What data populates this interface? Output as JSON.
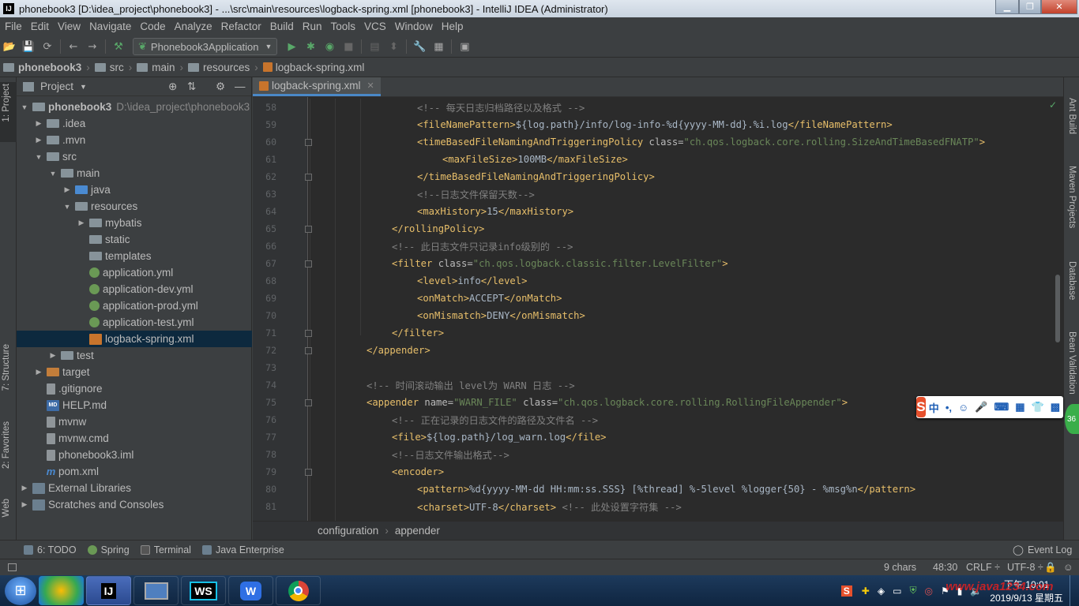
{
  "window": {
    "title": "phonebook3 [D:\\idea_project\\phonebook3] - ...\\src\\main\\resources\\logback-spring.xml [phonebook3] - IntelliJ IDEA (Administrator)",
    "app_icon": "IJ"
  },
  "menu": [
    "File",
    "Edit",
    "View",
    "Navigate",
    "Code",
    "Analyze",
    "Refactor",
    "Build",
    "Run",
    "Tools",
    "VCS",
    "Window",
    "Help"
  ],
  "toolbar": {
    "run_config": "Phonebook3Application"
  },
  "breadcrumbs": [
    "phonebook3",
    "src",
    "main",
    "resources",
    "logback-spring.xml"
  ],
  "left_strip": {
    "project": "1: Project",
    "structure": "7: Structure",
    "favorites": "2: Favorites",
    "web": "Web"
  },
  "right_strip": {
    "ant": "Ant Build",
    "maven": "Maven Projects",
    "database": "Database",
    "bean": "Bean Validation"
  },
  "project_panel": {
    "title": "Project",
    "tree": [
      {
        "label": "phonebook3",
        "hint": "D:\\idea_project\\phonebook3",
        "level": 0,
        "arrow": "▼",
        "icon": "folder",
        "bold": true
      },
      {
        "label": ".idea",
        "level": 1,
        "arrow": "▶",
        "icon": "folder"
      },
      {
        "label": ".mvn",
        "level": 1,
        "arrow": "▶",
        "icon": "folder"
      },
      {
        "label": "src",
        "level": 1,
        "arrow": "▼",
        "icon": "folder"
      },
      {
        "label": "main",
        "level": 2,
        "arrow": "▼",
        "icon": "folder"
      },
      {
        "label": "java",
        "level": 3,
        "arrow": "▶",
        "icon": "folder-blue"
      },
      {
        "label": "resources",
        "level": 3,
        "arrow": "▼",
        "icon": "folder"
      },
      {
        "label": "mybatis",
        "level": 4,
        "arrow": "▶",
        "icon": "folder"
      },
      {
        "label": "static",
        "level": 4,
        "arrow": "",
        "icon": "folder"
      },
      {
        "label": "templates",
        "level": 4,
        "arrow": "",
        "icon": "folder"
      },
      {
        "label": "application.yml",
        "level": 4,
        "arrow": "",
        "icon": "yml"
      },
      {
        "label": "application-dev.yml",
        "level": 4,
        "arrow": "",
        "icon": "yml"
      },
      {
        "label": "application-prod.yml",
        "level": 4,
        "arrow": "",
        "icon": "yml"
      },
      {
        "label": "application-test.yml",
        "level": 4,
        "arrow": "",
        "icon": "yml"
      },
      {
        "label": "logback-spring.xml",
        "level": 4,
        "arrow": "",
        "icon": "xml",
        "selected": true
      },
      {
        "label": "test",
        "level": 2,
        "arrow": "▶",
        "icon": "folder"
      },
      {
        "label": "target",
        "level": 1,
        "arrow": "▶",
        "icon": "folder-orange"
      },
      {
        "label": ".gitignore",
        "level": 1,
        "arrow": "",
        "icon": "file"
      },
      {
        "label": "HELP.md",
        "level": 1,
        "arrow": "",
        "icon": "md"
      },
      {
        "label": "mvnw",
        "level": 1,
        "arrow": "",
        "icon": "file"
      },
      {
        "label": "mvnw.cmd",
        "level": 1,
        "arrow": "",
        "icon": "file"
      },
      {
        "label": "phonebook3.iml",
        "level": 1,
        "arrow": "",
        "icon": "file"
      },
      {
        "label": "pom.xml",
        "level": 1,
        "arrow": "",
        "icon": "mvn"
      },
      {
        "label": "External Libraries",
        "level": 0,
        "arrow": "▶",
        "icon": "lib"
      },
      {
        "label": "Scratches and Consoles",
        "level": 0,
        "arrow": "▶",
        "icon": "lib"
      }
    ]
  },
  "editor": {
    "tab": "logback-spring.xml",
    "lines": [
      {
        "n": "58",
        "indent": 6,
        "fold": false,
        "tokens": [
          [
            "c",
            "<!-- 每天日志归档路径以及格式 -->"
          ]
        ]
      },
      {
        "n": "59",
        "indent": 6,
        "fold": false,
        "tokens": [
          [
            "t",
            "<fileNamePattern>"
          ],
          [
            "x",
            "${log.path}/info/log-info-%d{yyyy-MM-dd}.%i.log"
          ],
          [
            "t",
            "</fileNamePattern>"
          ]
        ]
      },
      {
        "n": "60",
        "indent": 6,
        "fold": true,
        "tokens": [
          [
            "t",
            "<timeBasedFileNamingAndTriggeringPolicy "
          ],
          [
            "a",
            "class="
          ],
          [
            "v",
            "\"ch.qos.logback.core.rolling.SizeAndTimeBasedFNATP\""
          ],
          [
            "t",
            ">"
          ]
        ]
      },
      {
        "n": "61",
        "indent": 8,
        "fold": false,
        "tokens": [
          [
            "t",
            "<maxFileSize>"
          ],
          [
            "x",
            "100MB"
          ],
          [
            "t",
            "</maxFileSize>"
          ]
        ]
      },
      {
        "n": "62",
        "indent": 6,
        "fold": true,
        "tokens": [
          [
            "t",
            "</timeBasedFileNamingAndTriggeringPolicy>"
          ]
        ]
      },
      {
        "n": "63",
        "indent": 6,
        "fold": false,
        "tokens": [
          [
            "c",
            "<!--日志文件保留天数-->"
          ]
        ]
      },
      {
        "n": "64",
        "indent": 6,
        "fold": false,
        "tokens": [
          [
            "t",
            "<maxHistory>"
          ],
          [
            "x",
            "15"
          ],
          [
            "t",
            "</maxHistory>"
          ]
        ]
      },
      {
        "n": "65",
        "indent": 4,
        "fold": true,
        "tokens": [
          [
            "t",
            "</rollingPolicy>"
          ]
        ]
      },
      {
        "n": "66",
        "indent": 4,
        "fold": false,
        "tokens": [
          [
            "c",
            "<!-- 此日志文件只记录info级别的 -->"
          ]
        ]
      },
      {
        "n": "67",
        "indent": 4,
        "fold": true,
        "tokens": [
          [
            "t",
            "<filter "
          ],
          [
            "a",
            "class="
          ],
          [
            "v",
            "\"ch.qos.logback.classic.filter.LevelFilter\""
          ],
          [
            "t",
            ">"
          ]
        ]
      },
      {
        "n": "68",
        "indent": 6,
        "fold": false,
        "tokens": [
          [
            "t",
            "<level>"
          ],
          [
            "x",
            "info"
          ],
          [
            "t",
            "</level>"
          ]
        ]
      },
      {
        "n": "69",
        "indent": 6,
        "fold": false,
        "tokens": [
          [
            "t",
            "<onMatch>"
          ],
          [
            "x",
            "ACCEPT"
          ],
          [
            "t",
            "</onMatch>"
          ]
        ]
      },
      {
        "n": "70",
        "indent": 6,
        "fold": false,
        "tokens": [
          [
            "t",
            "<onMismatch>"
          ],
          [
            "x",
            "DENY"
          ],
          [
            "t",
            "</onMismatch>"
          ]
        ]
      },
      {
        "n": "71",
        "indent": 4,
        "fold": true,
        "tokens": [
          [
            "t",
            "</filter>"
          ]
        ]
      },
      {
        "n": "72",
        "indent": 2,
        "fold": true,
        "tokens": [
          [
            "t",
            "</appender>"
          ]
        ]
      },
      {
        "n": "73",
        "indent": 0,
        "fold": false,
        "tokens": []
      },
      {
        "n": "74",
        "indent": 2,
        "fold": false,
        "tokens": [
          [
            "c",
            "<!-- 时间滚动输出 level为 WARN 日志 -->"
          ]
        ]
      },
      {
        "n": "75",
        "indent": 2,
        "fold": true,
        "tokens": [
          [
            "t",
            "<appender "
          ],
          [
            "a",
            "name="
          ],
          [
            "v",
            "\"WARN_FILE\" "
          ],
          [
            "a",
            "class="
          ],
          [
            "v",
            "\"ch.qos.logback.core.rolling.RollingFileAppender\""
          ],
          [
            "t",
            ">"
          ]
        ]
      },
      {
        "n": "76",
        "indent": 4,
        "fold": false,
        "tokens": [
          [
            "c",
            "<!-- 正在记录的日志文件的路径及文件名 -->"
          ]
        ]
      },
      {
        "n": "77",
        "indent": 4,
        "fold": false,
        "tokens": [
          [
            "t",
            "<file>"
          ],
          [
            "x",
            "${log.path}/log_warn.log"
          ],
          [
            "t",
            "</file>"
          ]
        ]
      },
      {
        "n": "78",
        "indent": 4,
        "fold": false,
        "tokens": [
          [
            "c",
            "<!--日志文件输出格式-->"
          ]
        ]
      },
      {
        "n": "79",
        "indent": 4,
        "fold": true,
        "tokens": [
          [
            "t",
            "<encoder>"
          ]
        ]
      },
      {
        "n": "80",
        "indent": 6,
        "fold": false,
        "tokens": [
          [
            "t",
            "<pattern>"
          ],
          [
            "x",
            "%d{yyyy-MM-dd HH:mm:ss.SSS} [%thread] %-5level %logger{50} - %msg%n"
          ],
          [
            "t",
            "</pattern>"
          ]
        ]
      },
      {
        "n": "81",
        "indent": 6,
        "fold": false,
        "tokens": [
          [
            "t",
            "<charset>"
          ],
          [
            "x",
            "UTF-8"
          ],
          [
            "t",
            "</charset> "
          ],
          [
            "c",
            "<!-- 此处设置字符集 -->"
          ]
        ]
      }
    ]
  },
  "editor_breadcrumb": [
    "configuration",
    "appender"
  ],
  "bottom_tools": [
    "6: TODO",
    "Spring",
    "Terminal",
    "Java Enterprise"
  ],
  "event_log": "Event Log",
  "status": {
    "chars": "9 chars",
    "position": "48:30",
    "line_sep": "CRLF ÷",
    "encoding": "UTF-8 ÷"
  },
  "ime": {
    "label": "中"
  },
  "taskbar": {
    "apps": [
      "IJ",
      "",
      "WS",
      "W",
      ""
    ],
    "clock_time": "下午 10:01",
    "clock_date": "2019/9/13 星期五",
    "watermark": "www.java1234.com"
  },
  "badge": "36"
}
